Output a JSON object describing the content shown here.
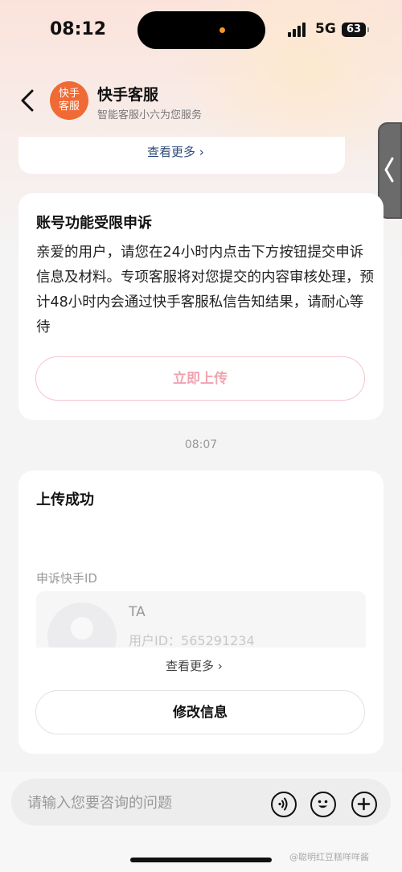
{
  "status_bar": {
    "time": "08:12",
    "network": "5G",
    "battery": "63"
  },
  "header": {
    "back_icon": "chevron-left-icon",
    "avatar_text_line1": "快手",
    "avatar_text_line2": "客服",
    "title": "快手客服",
    "subtitle": "智能客服小六为您服务"
  },
  "partial_card": {
    "more_label": "查看更多 ›"
  },
  "appeal_card": {
    "title": "账号功能受限申诉",
    "body": "亲爱的用户，请您在24小时内点击下方按钮提交申诉信息及材料。专项客服将对您提交的内容审核处理，预计48小时内会通过快手客服私信告知结果，请耐心等待",
    "button_label": "立即上传"
  },
  "timestamp": "08:07",
  "success_card": {
    "title": "上传成功",
    "field_label": "申诉快手ID",
    "user_name": "TA",
    "user_id": "用户ID：565291234",
    "more_label": "查看更多 ›",
    "button_label": "修改信息"
  },
  "input_bar": {
    "placeholder": "请输入您要咨询的问题",
    "icons": [
      "voice-icon",
      "emoji-icon",
      "plus-icon"
    ]
  },
  "watermark": "@聪明红豆糕咩咩酱",
  "colors": {
    "avatar_orange": "#f06a35",
    "upload_button_text": "#f2a3b0",
    "upload_button_border": "#f7c5cc",
    "link_blue": "#2e4a7a"
  }
}
